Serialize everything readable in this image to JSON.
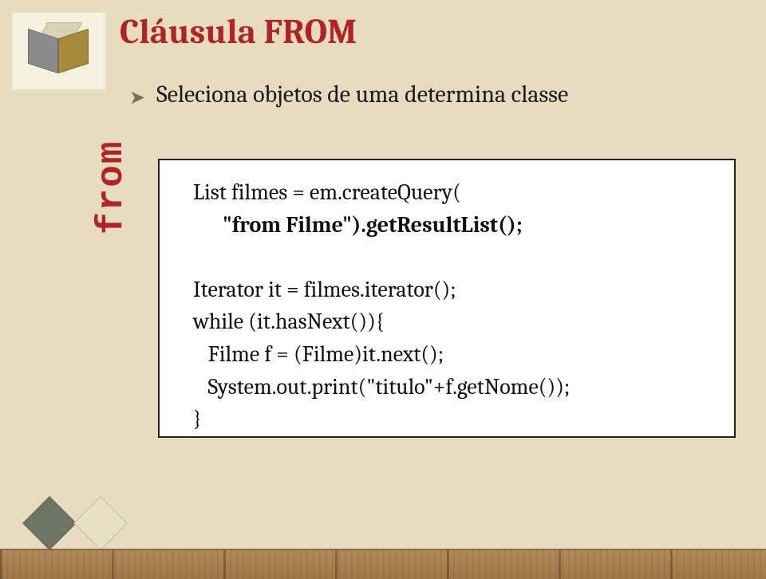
{
  "title": "Cláusula FROM",
  "bullet": "Seleciona objetos de uma determina classe",
  "side_label": "from",
  "code": {
    "l1": "List filmes = em.createQuery(",
    "l2": "      \"from Filme\").getResultList();",
    "l3": "",
    "l4": "Iterator it = filmes.iterator();",
    "l5": "while (it.hasNext()){",
    "l6": "   Filme f = (Filme)it.next();",
    "l7": "   System.out.print(\"titulo\"+f.getNome());",
    "l8": "}"
  }
}
